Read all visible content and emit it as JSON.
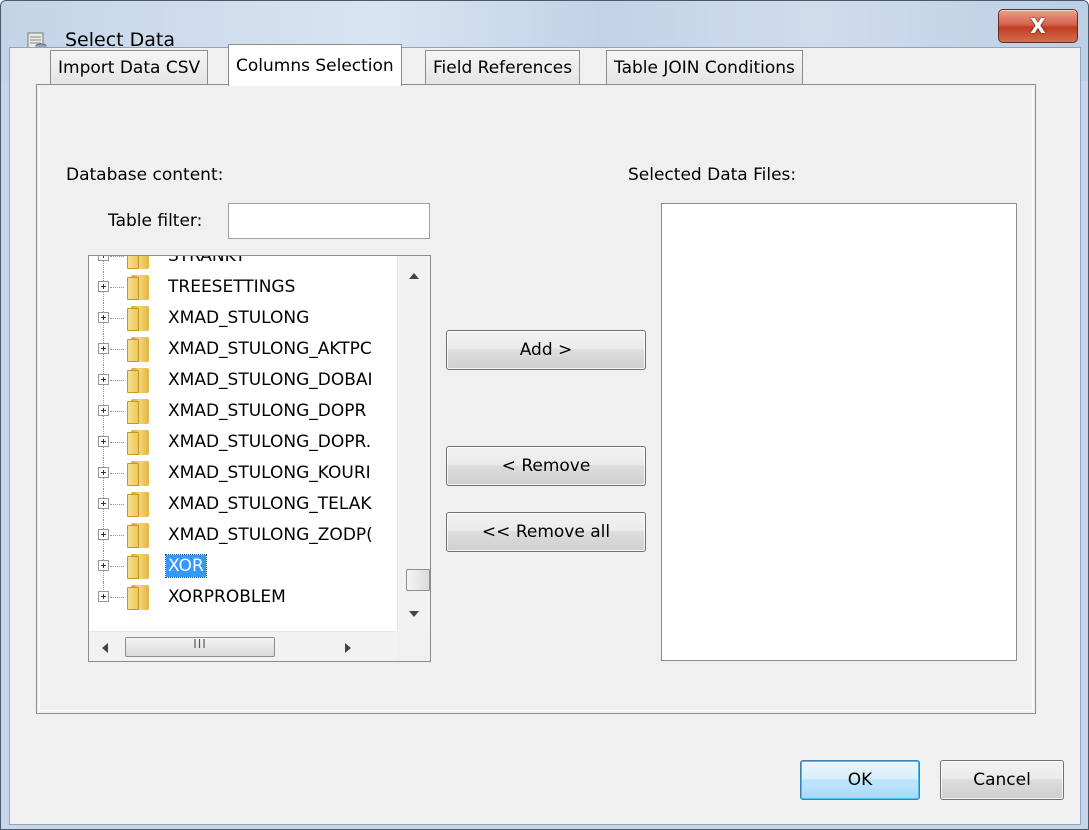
{
  "window": {
    "title": "Select Data",
    "close_glyph": "X",
    "icon": "database-icon"
  },
  "tabs": [
    {
      "label": "Import Data CSV",
      "active": false
    },
    {
      "label": "Columns Selection",
      "active": true
    },
    {
      "label": "Field References",
      "active": false
    },
    {
      "label": "Table JOIN Conditions",
      "active": false
    }
  ],
  "panel": {
    "database_content_label": "Database content:",
    "table_filter_label": "Table filter:",
    "table_filter_value": "",
    "selected_files_label": "Selected Data Files:",
    "selected_files": []
  },
  "tree": {
    "items": [
      {
        "label": "STRANKY",
        "selected": false
      },
      {
        "label": "TREESETTINGS",
        "selected": false
      },
      {
        "label": "XMAD_STULONG",
        "selected": false
      },
      {
        "label": "XMAD_STULONG_AKTPC",
        "selected": false
      },
      {
        "label": "XMAD_STULONG_DOBAI",
        "selected": false
      },
      {
        "label": "XMAD_STULONG_DOPR",
        "selected": false
      },
      {
        "label": "XMAD_STULONG_DOPR.",
        "selected": false
      },
      {
        "label": "XMAD_STULONG_KOURI",
        "selected": false
      },
      {
        "label": "XMAD_STULONG_TELAK",
        "selected": false
      },
      {
        "label": "XMAD_STULONG_ZODP(",
        "selected": false
      },
      {
        "label": "XOR",
        "selected": true
      },
      {
        "label": "XORPROBLEM",
        "selected": false
      }
    ],
    "hscroll_grip": "III"
  },
  "buttons": {
    "add": "Add >",
    "remove": "< Remove",
    "remove_all": "<< Remove all",
    "ok": "OK",
    "cancel": "Cancel"
  },
  "colors": {
    "selection": "#3399ff",
    "folder": "#e9c04b",
    "close_button": "#c9462c",
    "default_button": "#3c7fb1"
  }
}
